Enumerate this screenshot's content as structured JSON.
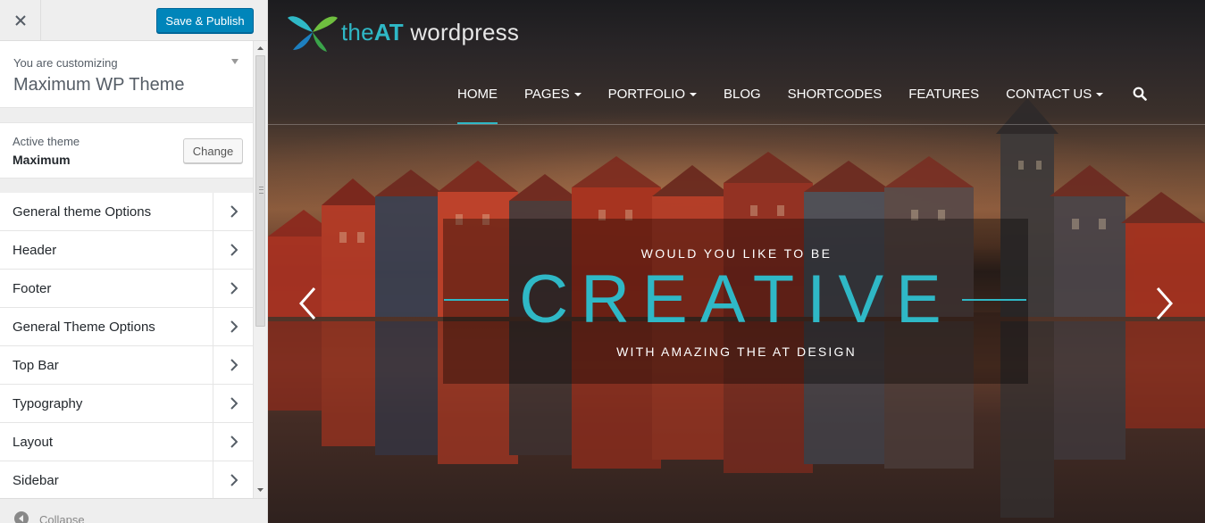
{
  "customizer": {
    "save_label": "Save & Publish",
    "info_label": "You are customizing",
    "info_title": "Maximum WP Theme",
    "active_theme_label": "Active theme",
    "active_theme_name": "Maximum",
    "change_label": "Change",
    "sections": [
      {
        "label": "General theme Options"
      },
      {
        "label": "Header"
      },
      {
        "label": "Footer"
      },
      {
        "label": "General Theme Options"
      },
      {
        "label": "Top Bar"
      },
      {
        "label": "Typography"
      },
      {
        "label": "Layout"
      },
      {
        "label": "Sidebar"
      }
    ],
    "collapse_label": "Collapse"
  },
  "site": {
    "logo_the": "the",
    "logo_at": "AT",
    "logo_rest": " wordpress",
    "nav": {
      "home": "HOME",
      "pages": "PAGES",
      "portfolio": "PORTFOLIO",
      "blog": "BLOG",
      "shortcodes": "SHORTCODES",
      "features": "FEATURES",
      "contact": "CONTACT US"
    },
    "slide": {
      "kicker": "WOULD YOU LIKE TO BE",
      "title": "CREATIVE",
      "subtitle": "WITH AMAZING THE AT DESIGN"
    }
  },
  "colors": {
    "accent": "#2fb8c6",
    "button_primary": "#0085ba"
  }
}
